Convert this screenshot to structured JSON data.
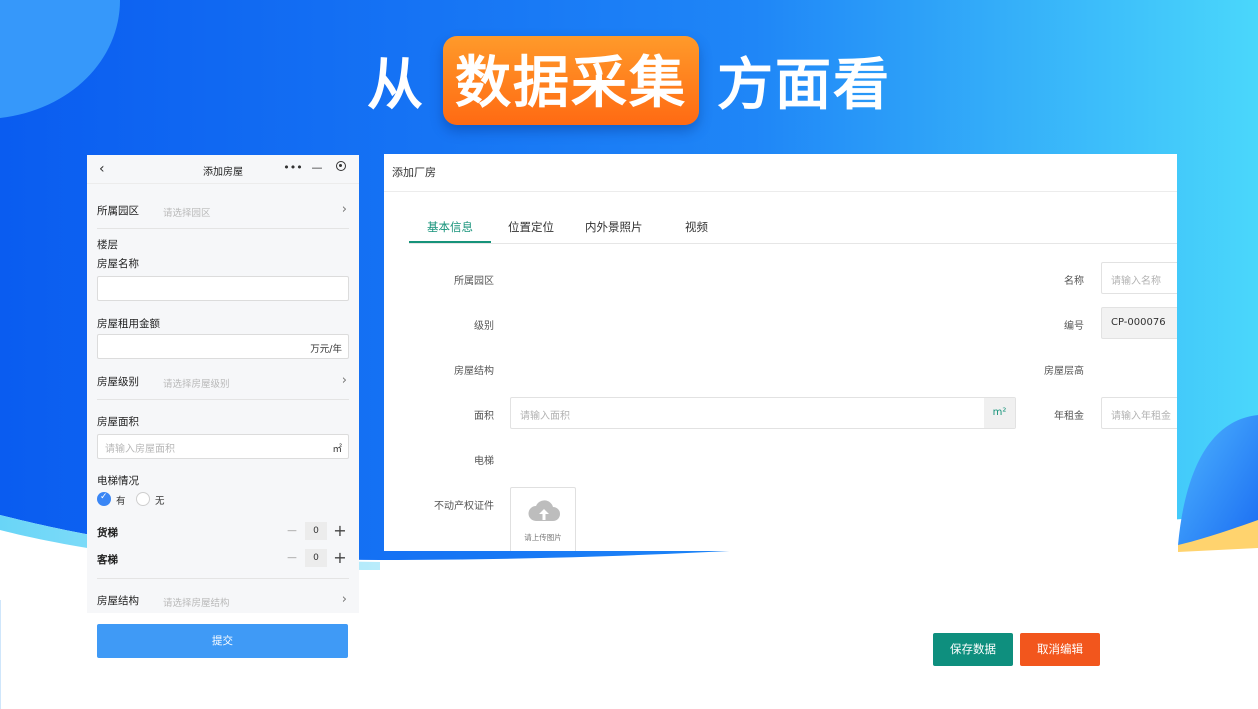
{
  "headline": {
    "prefix": "从",
    "highlight": "数据采集",
    "suffix": "方面看"
  },
  "mobile": {
    "title": "添加房屋",
    "back_icon": "chevron-left-icon",
    "capsule": {
      "more": "•••",
      "minimize": "—"
    },
    "park": {
      "label": "所属园区",
      "placeholder": "请选择园区"
    },
    "floor_label": "楼层",
    "house_name": {
      "label": "房屋名称",
      "value": ""
    },
    "rent": {
      "label": "房屋租用金额",
      "unit": "万元/年"
    },
    "level": {
      "label": "房屋级别",
      "placeholder": "请选择房屋级别"
    },
    "area": {
      "label": "房屋面积",
      "placeholder": "请输入房屋面积",
      "unit": "㎡"
    },
    "elevator": {
      "label": "电梯情况",
      "yes": "有",
      "no": "无",
      "selected": "有"
    },
    "freight": {
      "label": "货梯",
      "value": "0"
    },
    "passenger": {
      "label": "客梯",
      "value": "0"
    },
    "structure": {
      "label": "房屋结构",
      "placeholder": "请选择房屋结构"
    },
    "submit": "提交"
  },
  "desktop": {
    "title": "添加厂房",
    "tabs": [
      "基本信息",
      "位置定位",
      "内外景照片",
      "视频"
    ],
    "active_tab": "基本信息",
    "fields": {
      "park": "所属园区",
      "level": "级别",
      "structure": "房屋结构",
      "area": {
        "label": "面积",
        "placeholder": "请输入面积",
        "unit": "m²"
      },
      "elevator": "电梯",
      "certificate": "不动产权证件",
      "name": {
        "label": "名称",
        "placeholder": "请输入名称"
      },
      "code": {
        "label": "编号",
        "value": "CP-000076"
      },
      "height": "房屋层高",
      "annual_rent": {
        "label": "年租金",
        "placeholder": "请输入年租金"
      }
    },
    "upload_text": "请上传图片",
    "save": "保存数据",
    "cancel": "取消编辑"
  },
  "colors": {
    "brand_blue": "#1565f0",
    "highlight_orange": "#ff7a1a",
    "accent_teal": "#16937a",
    "cancel_orange": "#f2561d",
    "submit_blue": "#3f9af6"
  }
}
